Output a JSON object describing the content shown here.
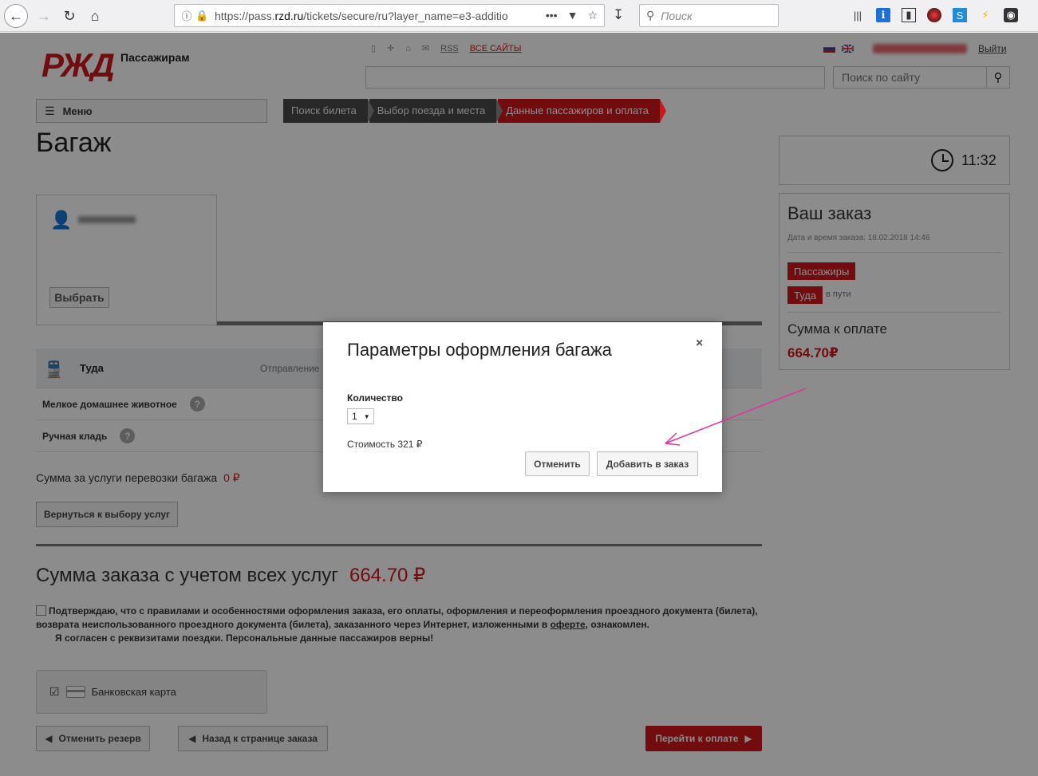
{
  "browser": {
    "url_prefix": "https://pass.",
    "url_domain": "rzd.ru",
    "url_suffix": "/tickets/secure/ru?layer_name=e3-additio",
    "search_placeholder": "Поиск",
    "icons": [
      "back-icon",
      "forward-icon",
      "reload-icon",
      "home-icon",
      "info-icon",
      "lock-icon",
      "more-icon",
      "pocket-icon",
      "star-icon",
      "download-icon",
      "search-icon",
      "library-icon",
      "extension-icon",
      "sidebar-icon",
      "extension-icon",
      "extension-icon",
      "extension-icon",
      "extension-icon"
    ]
  },
  "header": {
    "logo_caption": "Пассажирам",
    "rss_label": "RSS",
    "all_sites_label": "ВСЕ САЙТЫ",
    "logout_label": "Выйти",
    "site_search_placeholder": "Поиск по сайту"
  },
  "nav": {
    "menu_label": "Меню",
    "steps": [
      "Поиск билета",
      "Выбор поезда и места",
      "Данные пассажиров и оплата"
    ]
  },
  "page": {
    "title": "Багаж",
    "select_label": "Выбрать",
    "segment_dir": "Туда",
    "segment_dep": "Отправление",
    "services": [
      {
        "label": "Мелкое домашнее животное",
        "help": "?"
      },
      {
        "label": "Ручная кладь",
        "help": "?"
      }
    ],
    "bag_sum_label": "Сумма за услуги перевозки багажа",
    "bag_sum_value": "0 ₽",
    "back_services_label": "Вернуться к выбору услуг",
    "total_label": "Сумма заказа с учетом всех услуг",
    "total_value": "664.70 ₽",
    "agree_line1": "Подтверждаю, что с правилами и особенностями оформления заказа, его оплаты, оформления и переоформления проездного документа (билета),",
    "agree_line2a": "возврата неиспользованного проездного документа (билета), заказанного через Интернет, изложенными в ",
    "agree_link": "оферте",
    "agree_line2b": ", ознакомлен.",
    "agree_line3": "Я согласен с реквизитами поездки. Персональные данные пассажиров верны!",
    "pay_method": "Банковская карта",
    "cancel_reserve_label": "Отменить резерв",
    "back_order_label": "Назад к странице заказа",
    "go_pay_label": "Перейти к оплате"
  },
  "sidebar": {
    "timer": "11:32",
    "order_title": "Ваш заказ",
    "order_date": "Дата и время заказа: 18.02.2018 14:46",
    "passengers_tag": "Пассажиры",
    "direction_tag": "Туда",
    "direction_status": "в пути",
    "sum_label": "Сумма к оплате",
    "sum_value": "664.70₽"
  },
  "modal": {
    "title": "Параметры оформления багажа",
    "close": "×",
    "quantity_label": "Количество",
    "quantity_value": "1",
    "price_label": "Стоимость 321 ₽",
    "cancel_label": "Отменить",
    "add_label": "Добавить в заказ"
  },
  "colors": {
    "brand_red": "#d0161d",
    "annotation_arrow": "#e0359a"
  }
}
